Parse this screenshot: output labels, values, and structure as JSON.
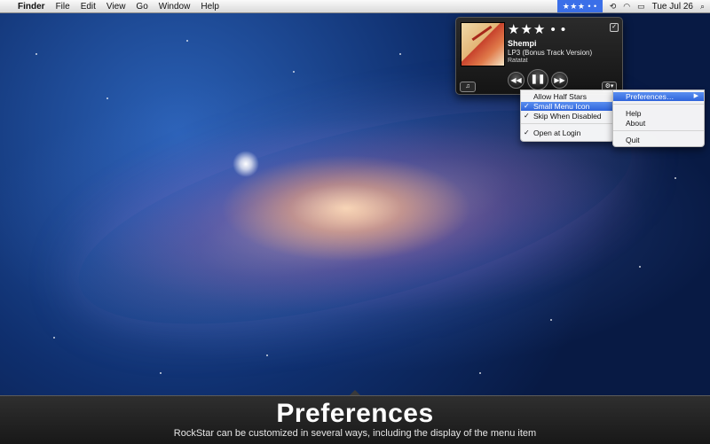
{
  "menubar": {
    "apple_icon": "",
    "app_name": "Finder",
    "menus": [
      "File",
      "Edit",
      "View",
      "Go",
      "Window",
      "Help"
    ],
    "status_item_stars": "★★★ • •",
    "clock": "Tue Jul 26",
    "icons": [
      "time-machine-icon",
      "wifi-icon",
      "battery-icon",
      "spotlight-icon"
    ]
  },
  "player": {
    "rating_stars": "★★★ • •",
    "track_title": "Shempi",
    "album": "LP3 (Bonus Track Version)",
    "artist": "Ratatat",
    "prev_symbol": "◀◀",
    "pause_symbol": "❚❚",
    "next_symbol": "▶▶",
    "itunes_symbol": "♫",
    "gear_symbol": "⚙▾",
    "check_symbol": "✓"
  },
  "main_menu": {
    "items": [
      {
        "label": "Allow Half Stars",
        "checked": false,
        "highlighted": false
      },
      {
        "label": "Small Menu Icon",
        "checked": true,
        "highlighted": true
      },
      {
        "label": "Skip When Disabled",
        "checked": true,
        "highlighted": false
      },
      {
        "label": "Open at Login",
        "checked": true,
        "highlighted": false
      }
    ],
    "check_mark": "✓"
  },
  "sub_menu": {
    "items": [
      {
        "label": "Preferences…",
        "highlighted": true
      },
      {
        "label": "Help"
      },
      {
        "label": "About"
      },
      {
        "label": "Quit"
      }
    ],
    "submenu_arrow": "▶"
  },
  "caption": {
    "title": "Preferences",
    "subtitle": "RockStar can be customized in several ways, including the display of the menu item"
  },
  "colors": {
    "highlight": "#3b6fe8",
    "caption_bg": "#222222"
  }
}
